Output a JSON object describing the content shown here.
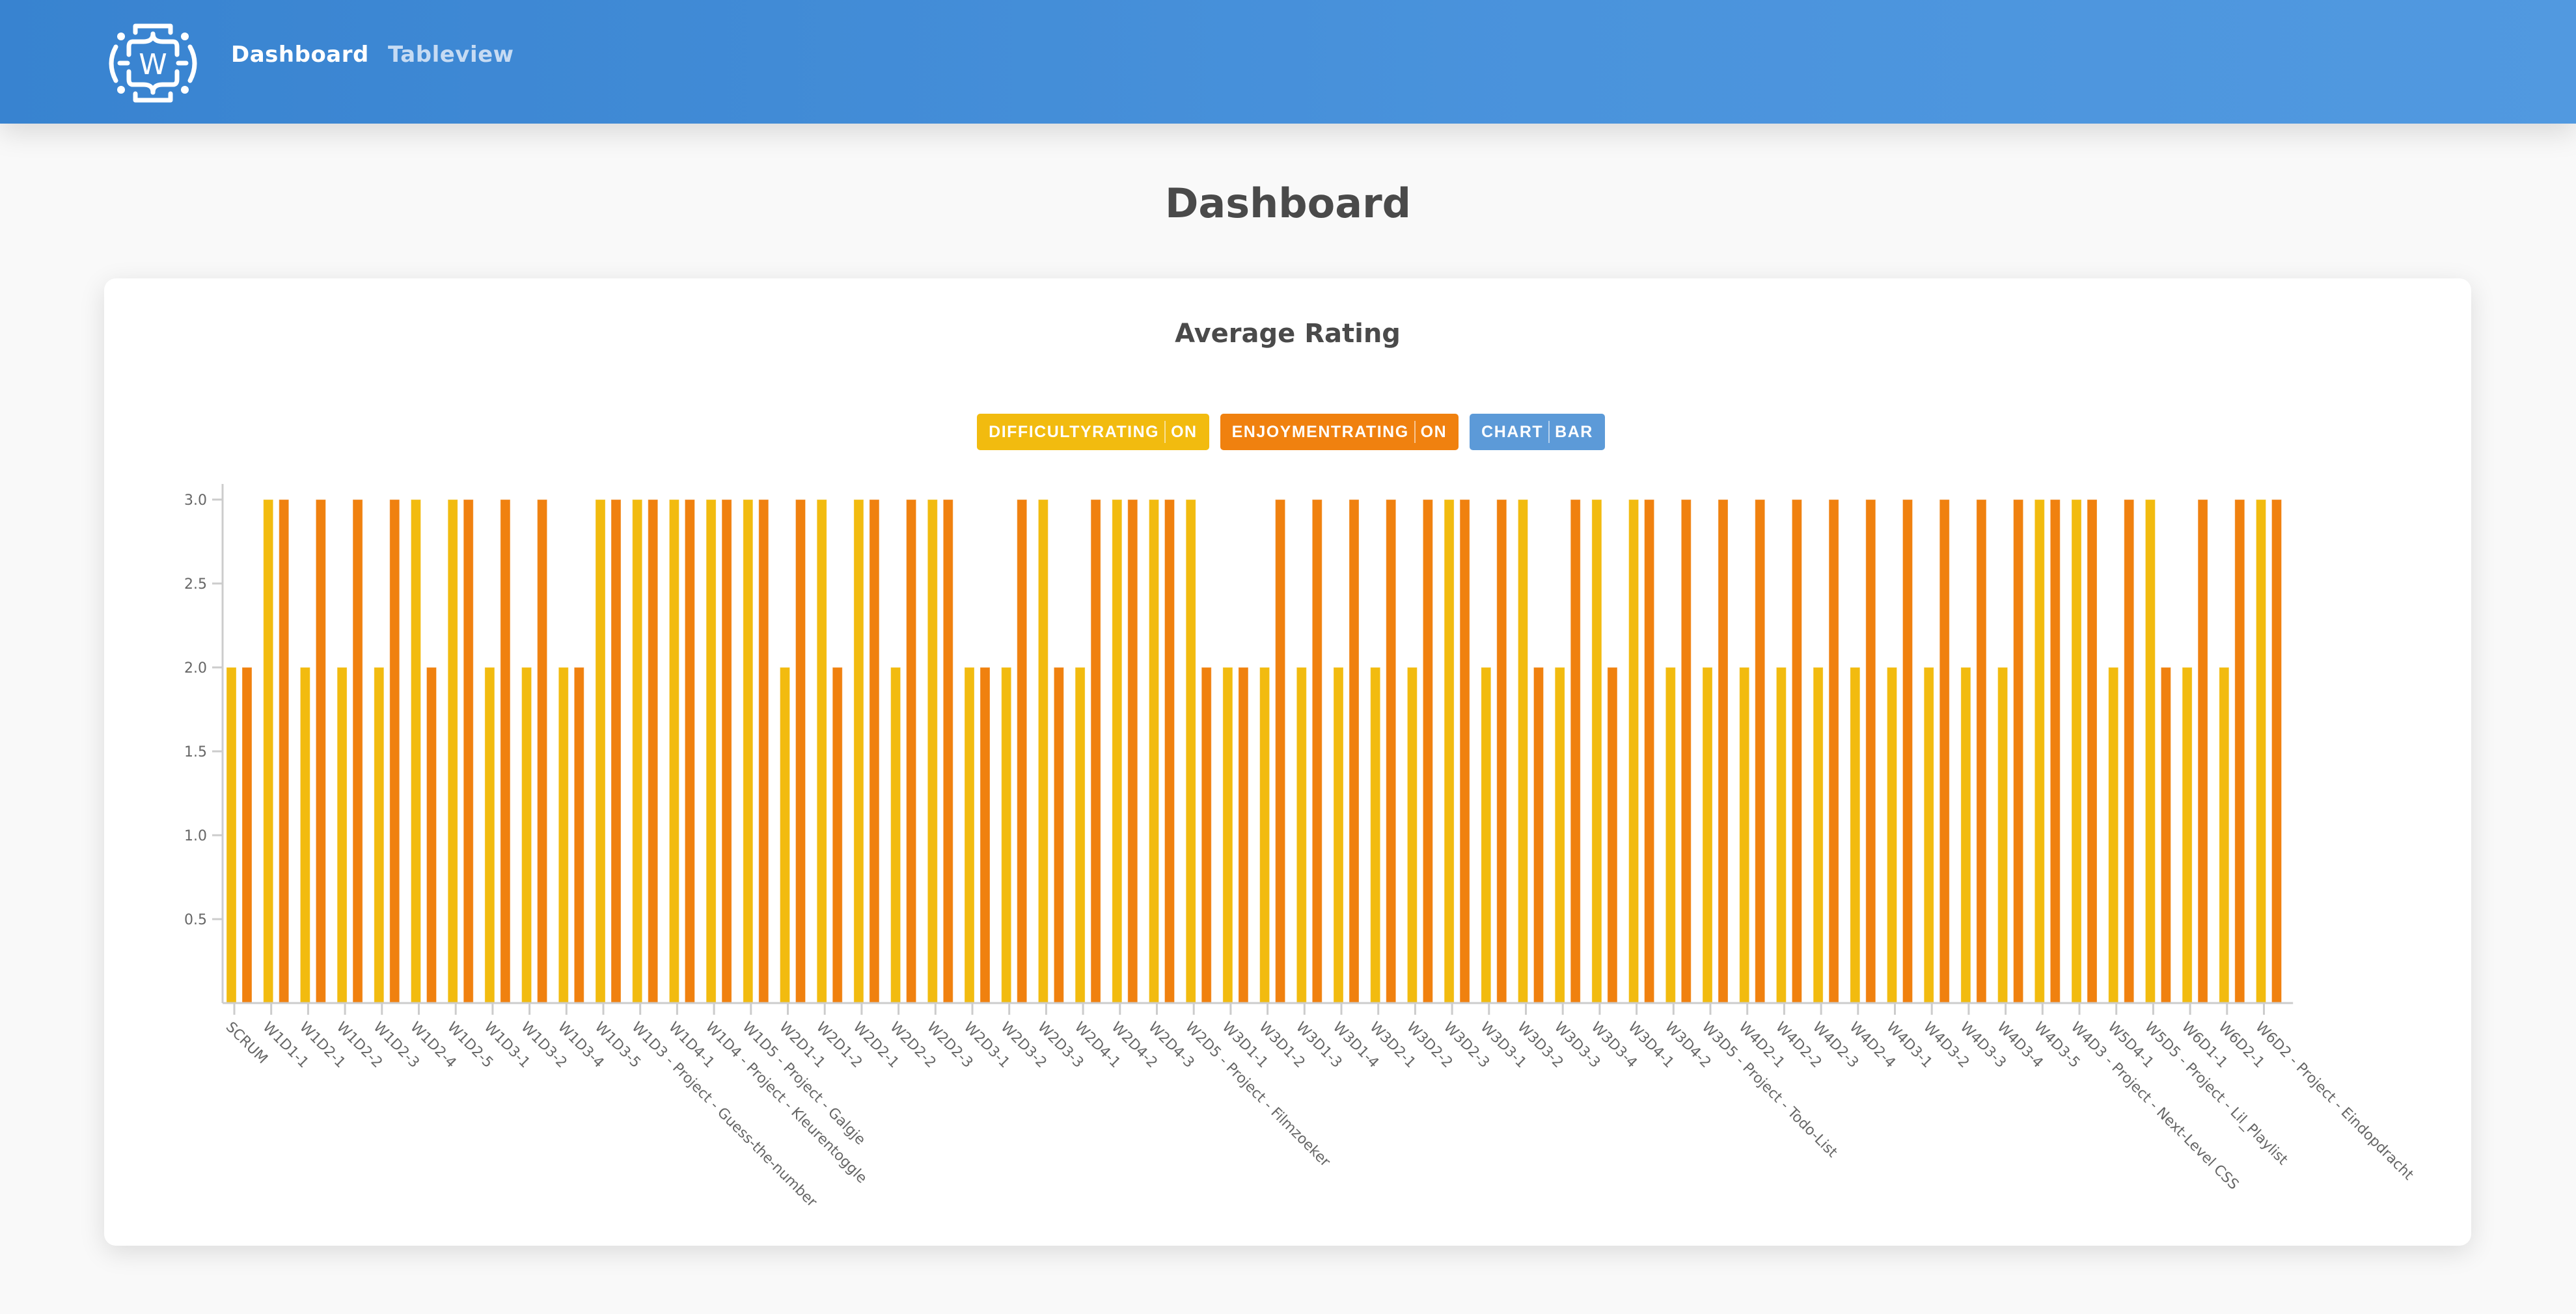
{
  "navbar": {
    "logo_icon": "webdev-bracket-w-logo",
    "links": [
      {
        "label": "Dashboard",
        "active": true
      },
      {
        "label": "Tableview",
        "active": false
      }
    ]
  },
  "page": {
    "title": "Dashboard"
  },
  "card": {
    "title": "Average Rating",
    "legend": [
      {
        "key": "difficultyrating",
        "label": "DIFFICULTYRATING",
        "state": "ON",
        "color": "#f2bb0f"
      },
      {
        "key": "enjoymentrating",
        "label": "ENJOYMENTRATING",
        "state": "ON",
        "color": "#f0810f"
      },
      {
        "key": "chart",
        "label": "CHART",
        "state": "BAR",
        "color": "#5c9ad8"
      }
    ]
  },
  "chart_data": {
    "type": "bar",
    "title": "Average Rating",
    "xlabel": "",
    "ylabel": "",
    "ylim": [
      0,
      3.0
    ],
    "yticks": [
      "0.5",
      "1.0",
      "1.5",
      "2.0",
      "2.5",
      "3.0"
    ],
    "ytick_values": [
      0.5,
      1.0,
      1.5,
      2.0,
      2.5,
      3.0
    ],
    "grid": false,
    "legend": "top-center",
    "categories": [
      "SCRUM",
      "W1D1-1",
      "W1D2-1",
      "W1D2-2",
      "W1D2-3",
      "W1D2-4",
      "W1D2-5",
      "W1D3-1",
      "W1D3-2",
      "W1D3-4",
      "W1D3-5",
      "W1D3 - Project - Guess-the-number",
      "W1D4-1",
      "W1D4 - Project - Kleurentoggle",
      "W1D5 - Project - Galgje",
      "W2D1-1",
      "W2D1-2",
      "W2D2-1",
      "W2D2-2",
      "W2D2-3",
      "W2D3-1",
      "W2D3-2",
      "W2D3-3",
      "W2D4-1",
      "W2D4-2",
      "W2D4-3",
      "W2D5 - Project - Filmzoeker",
      "W3D1-1",
      "W3D1-2",
      "W3D1-3",
      "W3D1-4",
      "W3D2-1",
      "W3D2-2",
      "W3D2-3",
      "W3D3-1",
      "W3D3-2",
      "W3D3-3",
      "W3D3-4",
      "W3D4-1",
      "W3D4-2",
      "W3D5 - Project - Todo-List",
      "W4D2-1",
      "W4D2-2",
      "W4D2-3",
      "W4D2-4",
      "W4D3-1",
      "W4D3-2",
      "W4D3-3",
      "W4D3-4",
      "W4D3-5",
      "W4D3 - Project - Next-Level CSS",
      "W5D4-1",
      "W5D5 - Project - Lil_Playlist",
      "W6D1-1",
      "W6D2-1",
      "W6D2 - Project - Eindopdracht"
    ],
    "series": [
      {
        "name": "difficultyRating",
        "color": "#f2bb0f",
        "values": [
          2,
          3,
          2,
          2,
          2,
          3,
          3,
          2,
          2,
          2,
          3,
          3,
          3,
          3,
          3,
          2,
          3,
          3,
          2,
          3,
          2,
          2,
          3,
          2,
          3,
          3,
          3,
          2,
          2,
          2,
          2,
          2,
          2,
          3,
          2,
          3,
          2,
          3,
          3,
          2,
          2,
          2,
          2,
          2,
          2,
          2,
          2,
          2,
          2,
          3,
          3,
          2,
          3,
          2,
          2,
          3
        ]
      },
      {
        "name": "enjoymentRating",
        "color": "#f0810f",
        "values": [
          2,
          3,
          3,
          3,
          3,
          2,
          3,
          3,
          3,
          2,
          3,
          3,
          3,
          3,
          3,
          3,
          2,
          3,
          3,
          3,
          2,
          3,
          2,
          3,
          3,
          3,
          2,
          2,
          3,
          3,
          3,
          3,
          3,
          3,
          3,
          2,
          3,
          2,
          3,
          3,
          3,
          3,
          3,
          3,
          3,
          3,
          3,
          3,
          3,
          3,
          3,
          3,
          2,
          3,
          3,
          3
        ]
      }
    ]
  }
}
